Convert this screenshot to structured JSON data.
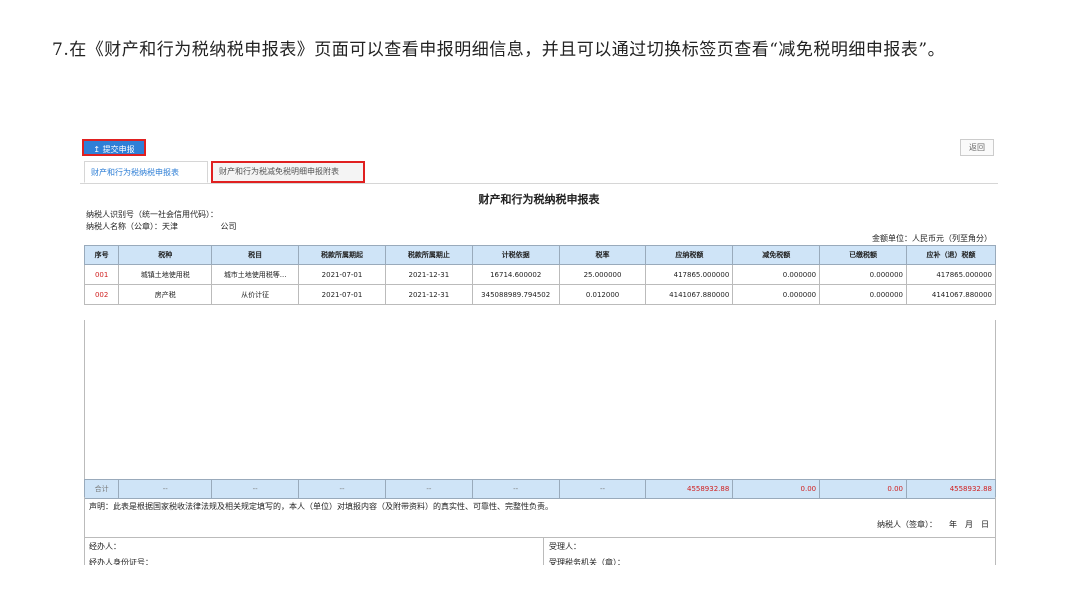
{
  "instruction": "7.在《财产和行为税纳税申报表》页面可以查看申报明细信息，并且可以通过切换标签页查看“减免税明细申报表”。",
  "toolbar": {
    "submit_icon": "↥",
    "submit_label": "提交申报",
    "back_label": "返回"
  },
  "tabs": [
    {
      "label": "财产和行为税纳税申报表"
    },
    {
      "label": "财产和行为税减免税明细申报附表"
    }
  ],
  "form": {
    "title": "财产和行为税纳税申报表",
    "taxpayer_id_label": "纳税人识别号（统一社会信用代码）：",
    "taxpayer_name_label": "纳税人名称（公章）：天津",
    "taxpayer_name_suffix": "公司",
    "unit_label": "金额单位：人民币元（列至角分）"
  },
  "table": {
    "headers": [
      "序号",
      "税种",
      "税目",
      "税款所属期起",
      "税款所属期止",
      "计税依据",
      "税率",
      "应纳税额",
      "减免税额",
      "已缴税额",
      "应补（退）税额"
    ],
    "rows": [
      [
        "001",
        "城镇土地使用税",
        "城市土地使用税等...",
        "2021-07-01",
        "2021-12-31",
        "16714.600002",
        "25.000000",
        "417865.000000",
        "0.000000",
        "0.000000",
        "417865.000000"
      ],
      [
        "002",
        "房产税",
        "从价计征",
        "2021-07-01",
        "2021-12-31",
        "345088989.794502",
        "0.012000",
        "4141067.880000",
        "0.000000",
        "0.000000",
        "4141067.880000"
      ]
    ],
    "total": [
      "合计",
      "--",
      "--",
      "--",
      "--",
      "--",
      "--",
      "4558932.88",
      "0.00",
      "0.00",
      "4558932.88"
    ]
  },
  "declaration": {
    "text": "声明：此表是根据国家税收法律法规及相关规定填写的，本人（单位）对填报内容（及附带资料）的真实性、可靠性、完整性负责。",
    "sign": "纳税人（签章）：　　年　月　日"
  },
  "footer": {
    "handler": "经办人：",
    "handler_id": "经办人身份证号：",
    "receiver": "受理人：",
    "receiving_office": "受理税务机关（章）："
  }
}
